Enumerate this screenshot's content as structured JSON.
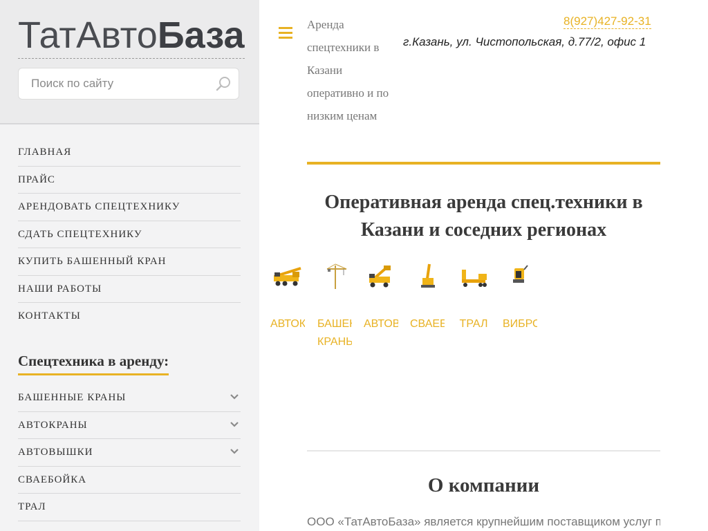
{
  "logo": {
    "part1": "ТатАвто",
    "part2": "База"
  },
  "search": {
    "placeholder": "Поиск по сайту",
    "value": ""
  },
  "nav": {
    "items": [
      "ГЛАВНАЯ",
      "ПРАЙС",
      "АРЕНДОВАТЬ СПЕЦТЕХНИКУ",
      "СДАТЬ СПЕЦТЕХНИКУ",
      "КУПИТЬ БАШЕННЫЙ КРАН",
      "НАШИ РАБОТЫ",
      "КОНТАКТЫ"
    ]
  },
  "catalog": {
    "title": "Спецтехника в аренду:",
    "items": [
      {
        "label": "БАШЕННЫЕ КРАНЫ",
        "expandable": true
      },
      {
        "label": "АВТОКРАНЫ",
        "expandable": true
      },
      {
        "label": "АВТОВЫШКИ",
        "expandable": true
      },
      {
        "label": "СВАЕБОЙКА",
        "expandable": false
      },
      {
        "label": "ТРАЛ",
        "expandable": false
      }
    ]
  },
  "header": {
    "tagline": "Аренда спецтехники в Казани оперативно и по низким ценам",
    "phone": "8(927)427-92-31",
    "address": "г.Казань, ул. Чистопольская, д.77/2, офис 1"
  },
  "hero": {
    "title": "Оперативная аренда спец.техники в Казани и соседних регионах"
  },
  "equipment": {
    "items": [
      {
        "label": "АВТОКРАНЫ",
        "icon": "truck-crane-icon"
      },
      {
        "label": "БАШЕННЫЕ КРАНЫ",
        "icon": "tower-crane-icon"
      },
      {
        "label": "АВТОВЫШКИ",
        "icon": "aerial-platform-icon"
      },
      {
        "label": "СВАЕБОЙКА",
        "icon": "pile-driver-icon"
      },
      {
        "label": "ТРАЛ",
        "icon": "trailer-icon"
      },
      {
        "label": "ВИБРОПЛИТЫ",
        "icon": "vibratory-plate-icon"
      }
    ]
  },
  "about": {
    "title": "О компании",
    "text": "ООО «ТатАвтоБаза» является крупнейшим поставщиком услуг по"
  },
  "colors": {
    "accent": "#e8b224",
    "sidebar_bg": "#f3f3f4",
    "sidebar_head_bg": "#ebebec",
    "text": "#333333"
  }
}
